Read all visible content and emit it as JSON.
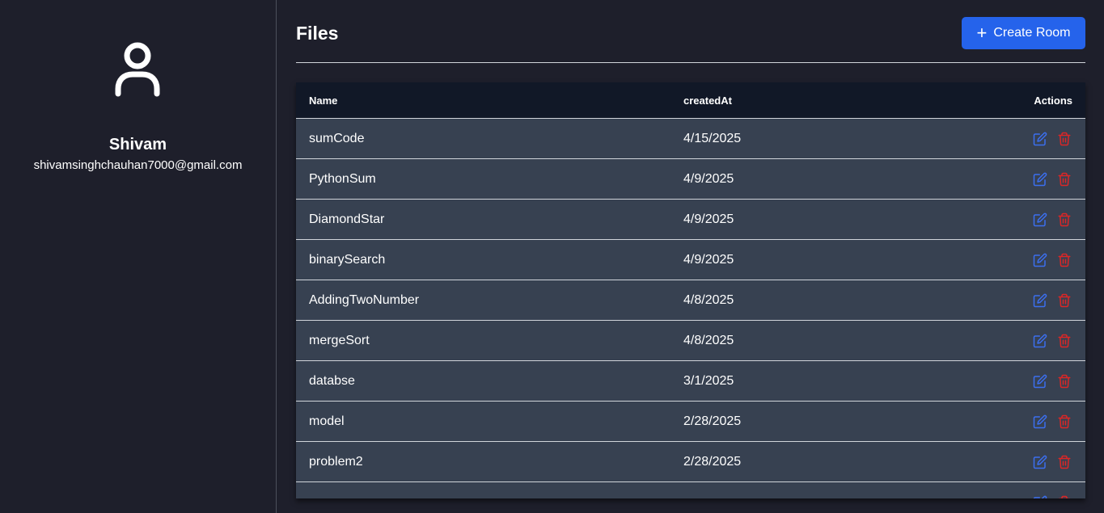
{
  "user": {
    "name": "Shivam",
    "email": "shivamsinghchauhan7000@gmail.com"
  },
  "header": {
    "title": "Files",
    "create_button_label": "Create Room"
  },
  "table": {
    "columns": [
      "Name",
      "createdAt",
      "Actions"
    ],
    "rows": [
      {
        "name": "sumCode",
        "createdAt": "4/15/2025"
      },
      {
        "name": "PythonSum",
        "createdAt": "4/9/2025"
      },
      {
        "name": "DiamondStar",
        "createdAt": "4/9/2025"
      },
      {
        "name": "binarySearch",
        "createdAt": "4/9/2025"
      },
      {
        "name": "AddingTwoNumber",
        "createdAt": "4/8/2025"
      },
      {
        "name": "mergeSort",
        "createdAt": "4/8/2025"
      },
      {
        "name": "databse",
        "createdAt": "3/1/2025"
      },
      {
        "name": "model",
        "createdAt": "2/28/2025"
      },
      {
        "name": "problem2",
        "createdAt": "2/28/2025"
      },
      {
        "name": "",
        "createdAt": ""
      }
    ]
  },
  "icons": {
    "avatar": "user-icon",
    "create": "plus-icon",
    "edit": "edit-icon",
    "delete": "trash-icon"
  },
  "colors": {
    "accent": "#2563eb",
    "edit_icon": "#3b6ff0",
    "delete_icon": "#dc2626",
    "row_bg": "#374151",
    "header_bg": "#111827",
    "page_bg": "#1e1f2b"
  }
}
